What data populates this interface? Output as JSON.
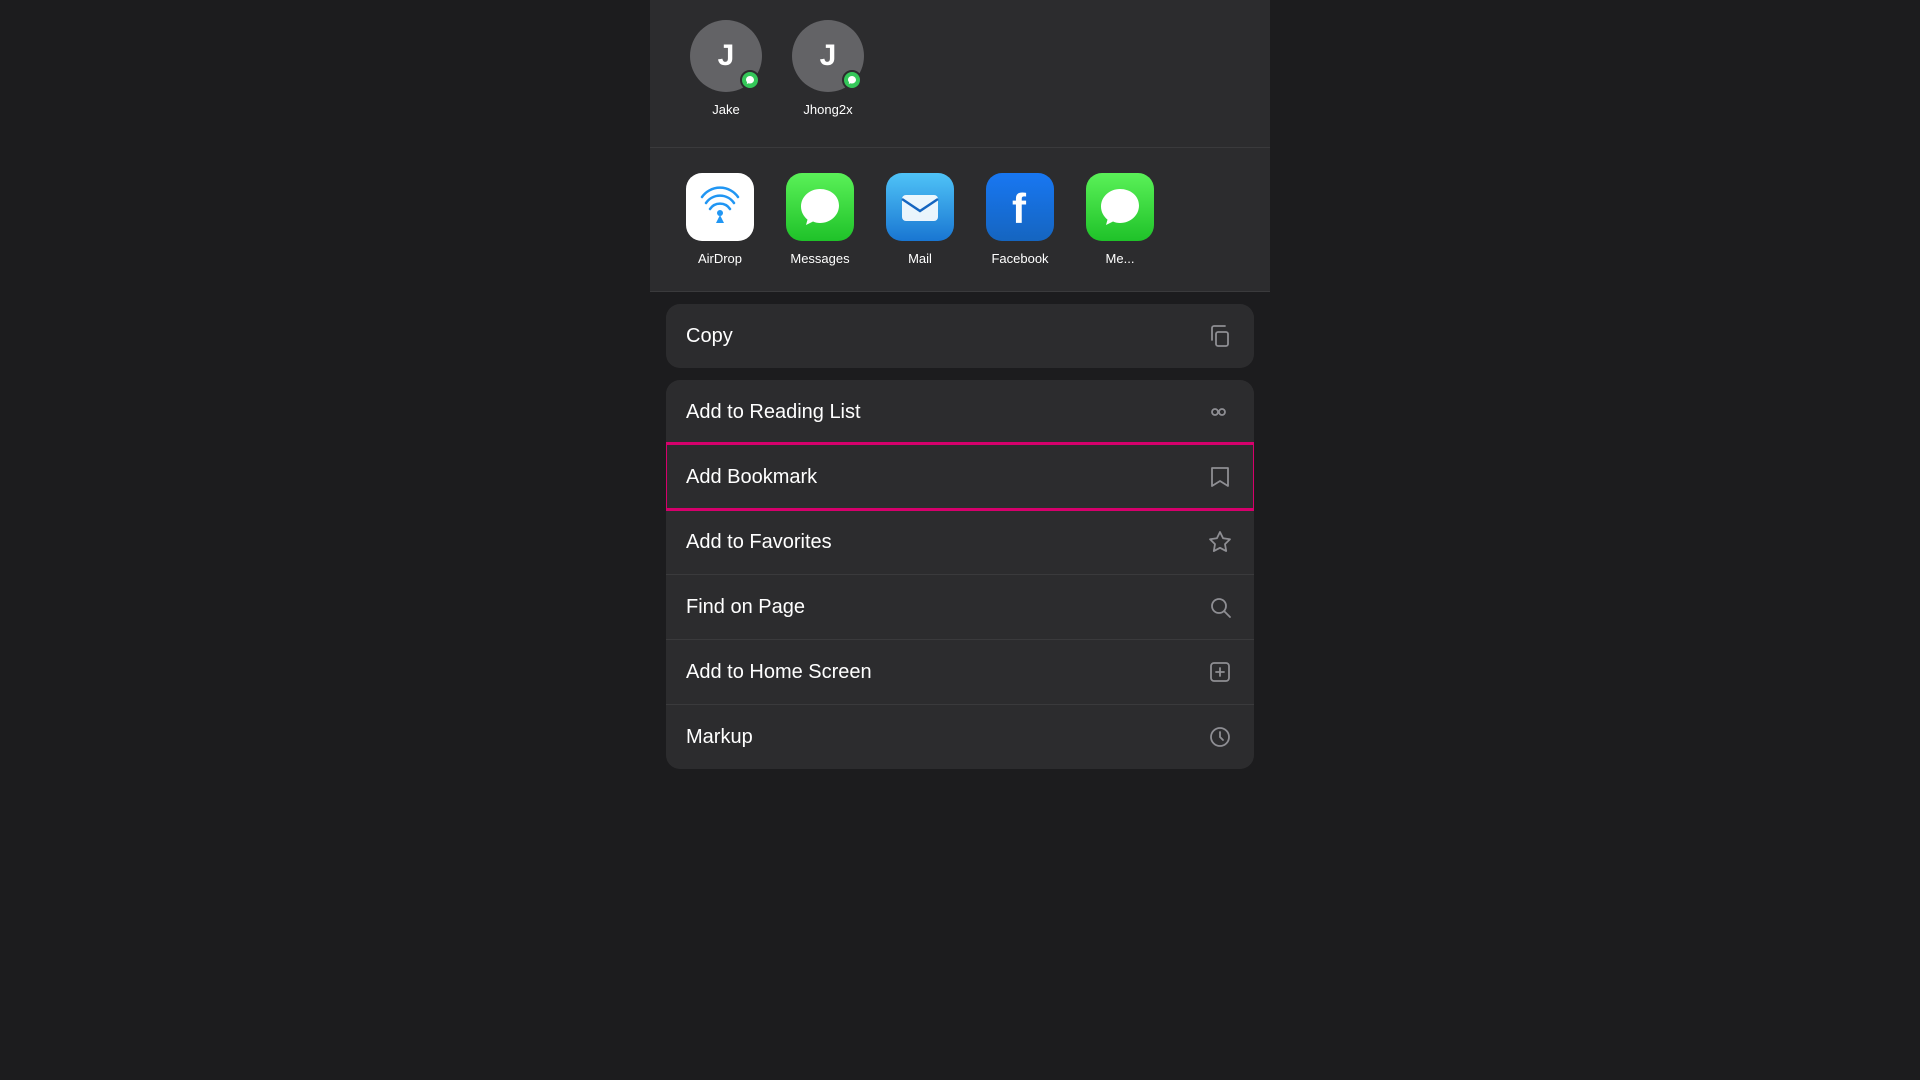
{
  "people": [
    {
      "id": "jake",
      "initial": "J",
      "name": "Jake",
      "hasMessage": true
    },
    {
      "id": "jhong2x",
      "initial": "J",
      "name": "Jhong2x",
      "hasMessage": true
    }
  ],
  "apps": [
    {
      "id": "airdrop",
      "name": "AirDrop",
      "type": "airdrop"
    },
    {
      "id": "messages",
      "name": "Messages",
      "type": "messages"
    },
    {
      "id": "mail",
      "name": "Mail",
      "type": "mail"
    },
    {
      "id": "facebook",
      "name": "Facebook",
      "type": "facebook"
    },
    {
      "id": "more",
      "name": "Me...",
      "type": "more"
    }
  ],
  "actions": [
    {
      "id": "copy",
      "label": "Copy",
      "icon": "copy"
    },
    {
      "id": "add-to-reading-list",
      "label": "Add to Reading List",
      "icon": "reading-list"
    },
    {
      "id": "add-bookmark",
      "label": "Add Bookmark",
      "icon": "bookmark",
      "highlighted": true
    },
    {
      "id": "add-to-favorites",
      "label": "Add to Favorites",
      "icon": "star"
    },
    {
      "id": "find-on-page",
      "label": "Find on Page",
      "icon": "search"
    },
    {
      "id": "add-to-home-screen",
      "label": "Add to Home Screen",
      "icon": "add-square"
    },
    {
      "id": "markup",
      "label": "Markup",
      "icon": "markup"
    }
  ],
  "highlight_color": "#d6006c"
}
